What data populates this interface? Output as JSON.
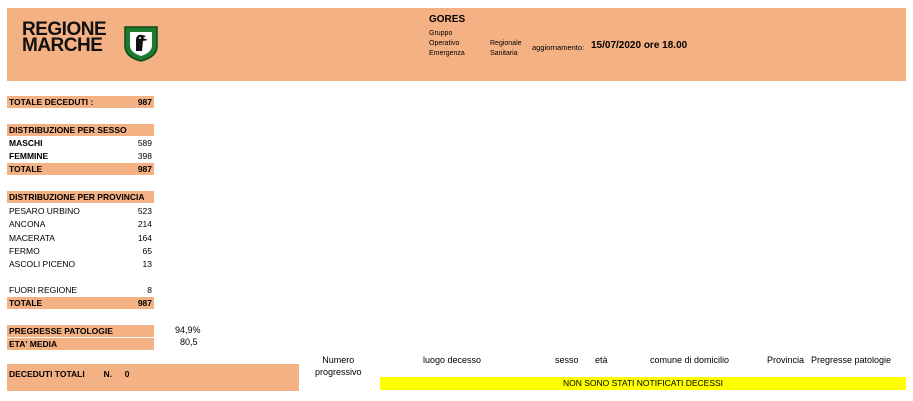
{
  "header": {
    "logo_line1": "REGIONE",
    "logo_line2": "MARCHE",
    "gores_title": "GORES",
    "gores_sub": [
      "Gruppo",
      "Operativo",
      "Emergenza"
    ],
    "regionale_sub": [
      "Regionale",
      "Sanitaria"
    ],
    "aggiornamento_label": "aggiornamento:",
    "update_time": "15/07/2020 ore 18.00"
  },
  "totale_deceduti": {
    "label": "TOTALE DECEDUTI :",
    "value": "987"
  },
  "sesso": {
    "title": "DISTRIBUZIONE PER SESSO",
    "rows": [
      {
        "label": "MASCHI",
        "value": "589"
      },
      {
        "label": "FEMMINE",
        "value": "398"
      }
    ],
    "totale": {
      "label": "TOTALE",
      "value": "987"
    }
  },
  "provincia": {
    "title": "DISTRIBUZIONE PER PROVINCIA",
    "rows": [
      {
        "label": "PESARO URBINO",
        "value": "523"
      },
      {
        "label": "ANCONA",
        "value": "214"
      },
      {
        "label": "MACERATA",
        "value": "164"
      },
      {
        "label": "FERMO",
        "value": "65"
      },
      {
        "label": "ASCOLI PICENO",
        "value": "13"
      }
    ],
    "fuori": {
      "label": "FUORI REGIONE",
      "value": "8"
    },
    "totale": {
      "label": "TOTALE",
      "value": "987"
    }
  },
  "pregresse": {
    "label": "PREGRESSE PATOLOGIE",
    "value": "94,9%"
  },
  "eta_media": {
    "label": "ETA' MEDIA",
    "value": "80,5"
  },
  "deceduti_totali": {
    "label": "DECEDUTI TOTALI",
    "n_label": "N.",
    "value": "0"
  },
  "columns": {
    "numero": [
      "Numero",
      "progressivo"
    ],
    "luogo": "luogo decesso",
    "sesso": "sesso",
    "eta": "età",
    "comune": "comune di domicilio",
    "provincia": "Provincia",
    "patologie": "Pregresse patologie"
  },
  "notice": "NON SONO STATI NOTIFICATI DECESSI",
  "colors": {
    "peach": "#f4b183",
    "notice_yellow": "#ffff00",
    "logo_green": "#1d7a2e"
  }
}
